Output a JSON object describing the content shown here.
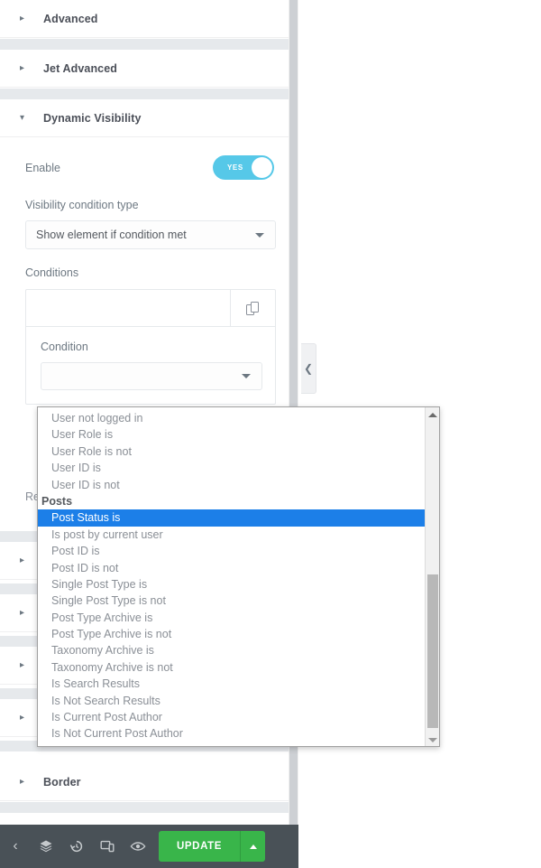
{
  "panel": {
    "sections_top": [
      {
        "label": "Advanced",
        "expanded": false,
        "arrow": "chevron-right"
      },
      {
        "label": "Jet Advanced",
        "expanded": false,
        "arrow": "chevron-right"
      },
      {
        "label": "Dynamic Visibility",
        "expanded": true,
        "arrow": "chevron-down"
      }
    ],
    "sections_bottom": [
      {
        "label": "Border",
        "expanded": false,
        "arrow": "chevron-right"
      }
    ],
    "dynamic_visibility": {
      "enable": {
        "label": "Enable",
        "value": "YES",
        "state": "on"
      },
      "visibility_condition_type": {
        "label": "Visibility condition type",
        "value": "Show element if condition met"
      },
      "conditions": {
        "label": "Conditions",
        "copy_icon": "copy-icon",
        "item": {
          "condition_label": "Condition",
          "condition_value": ""
        }
      },
      "truncated_label": "Re"
    }
  },
  "dropdown": {
    "open": true,
    "selected": "Post Status is",
    "items": [
      {
        "label": "User not logged in",
        "group": false
      },
      {
        "label": "User Role is",
        "group": false
      },
      {
        "label": "User Role is not",
        "group": false
      },
      {
        "label": "User ID is",
        "group": false
      },
      {
        "label": "User ID is not",
        "group": false
      },
      {
        "label": "Posts",
        "group": true
      },
      {
        "label": "Post Status is",
        "group": false,
        "selected": true
      },
      {
        "label": "Is post by current user",
        "group": false
      },
      {
        "label": "Post ID is",
        "group": false
      },
      {
        "label": "Post ID is not",
        "group": false
      },
      {
        "label": "Single Post Type is",
        "group": false
      },
      {
        "label": "Single Post Type is not",
        "group": false
      },
      {
        "label": "Post Type Archive is",
        "group": false
      },
      {
        "label": "Post Type Archive is not",
        "group": false
      },
      {
        "label": "Taxonomy Archive is",
        "group": false
      },
      {
        "label": "Taxonomy Archive is not",
        "group": false
      },
      {
        "label": "Is Search Results",
        "group": false
      },
      {
        "label": "Is Not Search Results",
        "group": false
      },
      {
        "label": "Is Current Post Author",
        "group": false
      },
      {
        "label": "Is Not Current Post Author",
        "group": false
      }
    ],
    "scrollbar": {
      "up_arrow": "triangle-up-icon",
      "down_arrow": "triangle-down-icon"
    }
  },
  "collapse_handle": {
    "icon": "chevron-left-icon"
  },
  "bottom_bar": {
    "icons": [
      {
        "name": "chevron-left-icon",
        "glyph": "‹"
      },
      {
        "name": "layers-icon",
        "glyph": "≡"
      },
      {
        "name": "history-icon",
        "glyph": "↺"
      },
      {
        "name": "responsive-mode-icon",
        "glyph": "▣"
      },
      {
        "name": "preview-eye-icon",
        "glyph": "◉"
      }
    ],
    "update_label": "UPDATE",
    "update_caret": "triangle-up-icon",
    "accent_color": "#39b54a",
    "bar_color": "#495157"
  },
  "colors": {
    "toggle_on": "#56c8e8",
    "dropdown_highlight": "#1c7fe8",
    "section_divider": "#e6e9ec"
  }
}
